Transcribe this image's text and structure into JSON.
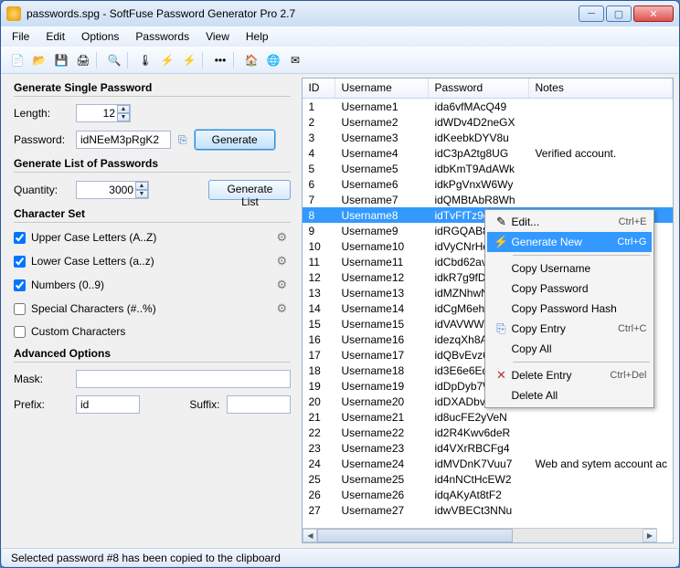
{
  "window": {
    "title": "passwords.spg - SoftFuse Password Generator Pro 2.7"
  },
  "menu": [
    "File",
    "Edit",
    "Options",
    "Passwords",
    "View",
    "Help"
  ],
  "sections": {
    "single": "Generate Single Password",
    "list": "Generate List of Passwords",
    "charset": "Character Set",
    "advanced": "Advanced Options"
  },
  "labels": {
    "length": "Length:",
    "password": "Password:",
    "quantity": "Quantity:",
    "mask": "Mask:",
    "prefix": "Prefix:",
    "suffix": "Suffix:"
  },
  "values": {
    "length": "12",
    "password": "idNEeM3pRgK2",
    "quantity": "3000",
    "mask": "",
    "prefix": "id",
    "suffix": ""
  },
  "buttons": {
    "generate": "Generate",
    "generate_list": "Generate List"
  },
  "charset": {
    "upper": "Upper Case Letters (A..Z)",
    "lower": "Lower Case Letters (a..z)",
    "numbers": "Numbers (0..9)",
    "special": "Special Characters (#..%)",
    "custom": "Custom Characters"
  },
  "columns": {
    "id": "ID",
    "user": "Username",
    "pass": "Password",
    "notes": "Notes"
  },
  "rows": [
    {
      "id": "1",
      "user": "Username1",
      "pass": "ida6vfMAcQ49",
      "notes": ""
    },
    {
      "id": "2",
      "user": "Username2",
      "pass": "idWDv4D2neGX",
      "notes": ""
    },
    {
      "id": "3",
      "user": "Username3",
      "pass": "idKeebkDYV8u",
      "notes": ""
    },
    {
      "id": "4",
      "user": "Username4",
      "pass": "idC3pA2tg8UG",
      "notes": "Verified account."
    },
    {
      "id": "5",
      "user": "Username5",
      "pass": "idbKmT9AdAWk",
      "notes": ""
    },
    {
      "id": "6",
      "user": "Username6",
      "pass": "idkPgVnxW6Wy",
      "notes": ""
    },
    {
      "id": "7",
      "user": "Username7",
      "pass": "idQMBtAbR8Wh",
      "notes": ""
    },
    {
      "id": "8",
      "user": "Username8",
      "pass": "idTvFfTz9gqz",
      "notes": ""
    },
    {
      "id": "9",
      "user": "Username9",
      "pass": "idRGQAB8AaKB",
      "notes": ""
    },
    {
      "id": "10",
      "user": "Username10",
      "pass": "idVyCNrHqr96",
      "notes": ""
    },
    {
      "id": "11",
      "user": "Username11",
      "pass": "idCbd62avMkM",
      "notes": ""
    },
    {
      "id": "12",
      "user": "Username12",
      "pass": "idkR7g9fDqxn",
      "notes": ""
    },
    {
      "id": "13",
      "user": "Username13",
      "pass": "idMZNhwNEX7m",
      "notes": ""
    },
    {
      "id": "14",
      "user": "Username14",
      "pass": "idCgM6ehCmdY",
      "notes": ""
    },
    {
      "id": "15",
      "user": "Username15",
      "pass": "idVAVWWV2ac2",
      "notes": ""
    },
    {
      "id": "16",
      "user": "Username16",
      "pass": "idezqXh8AyDw",
      "notes": ""
    },
    {
      "id": "17",
      "user": "Username17",
      "pass": "idQBvEvz6Fpg",
      "notes": ""
    },
    {
      "id": "18",
      "user": "Username18",
      "pass": "id3E6e6EqdCC",
      "notes": ""
    },
    {
      "id": "19",
      "user": "Username19",
      "pass": "idDpDyb7WMr8",
      "notes": ""
    },
    {
      "id": "20",
      "user": "Username20",
      "pass": "idDXADbvq97m",
      "notes": ""
    },
    {
      "id": "21",
      "user": "Username21",
      "pass": "id8ucFE2yVeN",
      "notes": ""
    },
    {
      "id": "22",
      "user": "Username22",
      "pass": "id2R4Kwv6deR",
      "notes": ""
    },
    {
      "id": "23",
      "user": "Username23",
      "pass": "id4VXrRBCFg4",
      "notes": ""
    },
    {
      "id": "24",
      "user": "Username24",
      "pass": "idMVDnK7Vuu7",
      "notes": "Web and sytem account ac"
    },
    {
      "id": "25",
      "user": "Username25",
      "pass": "id4nNCtHcEW2",
      "notes": ""
    },
    {
      "id": "26",
      "user": "Username26",
      "pass": "idqAKyAt8tF2",
      "notes": ""
    },
    {
      "id": "27",
      "user": "Username27",
      "pass": "idwVBECt3NNu",
      "notes": ""
    }
  ],
  "selected_row": 7,
  "context_menu": {
    "edit": "Edit...",
    "edit_k": "Ctrl+E",
    "gennew": "Generate New",
    "gennew_k": "Ctrl+G",
    "copyuser": "Copy Username",
    "copypass": "Copy Password",
    "copyhash": "Copy Password Hash",
    "copyentry": "Copy Entry",
    "copyentry_k": "Ctrl+C",
    "copyall": "Copy All",
    "delentry": "Delete Entry",
    "delentry_k": "Ctrl+Del",
    "delall": "Delete All"
  },
  "status": "Selected password #8 has been copied to the clipboard"
}
